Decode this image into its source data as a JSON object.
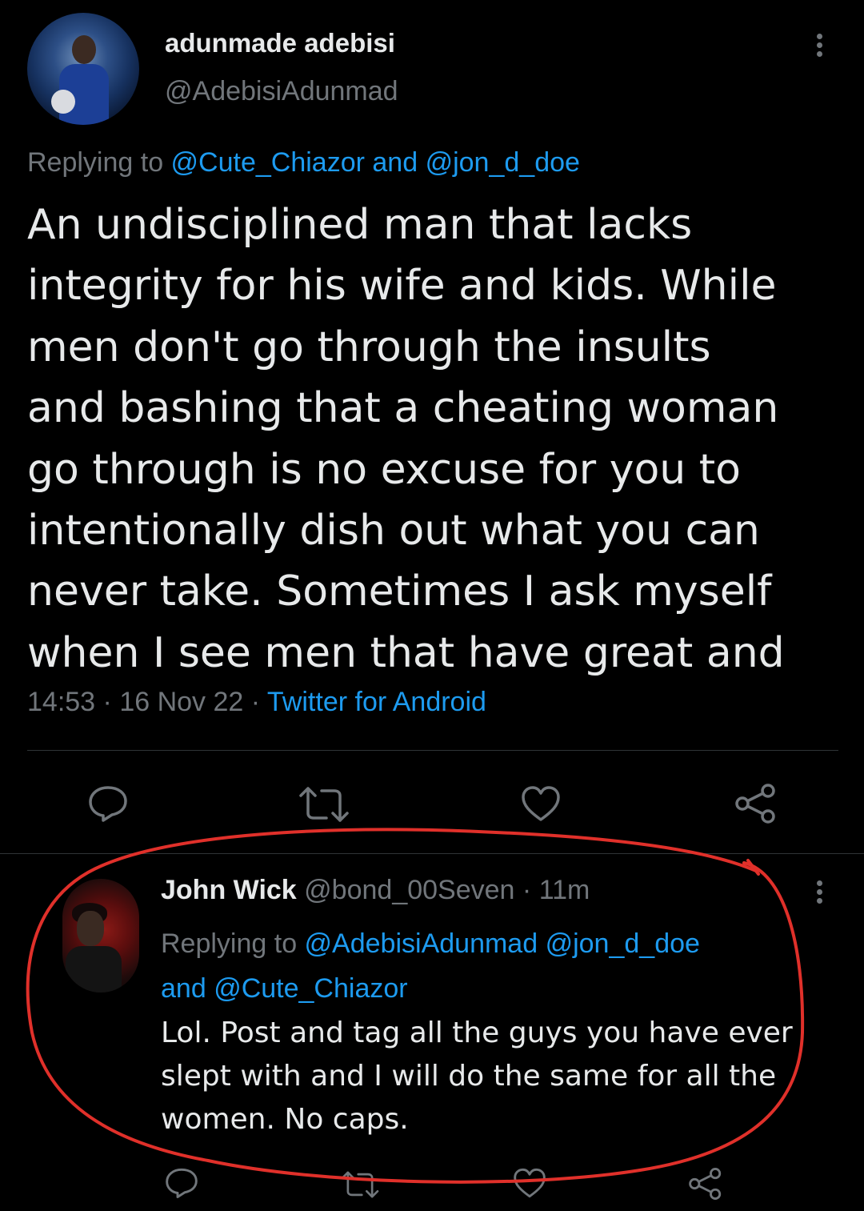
{
  "main_tweet": {
    "author_name": "adunmade adebisi",
    "author_handle": "@AdebisiAdunmad",
    "replying_prefix": "Replying to ",
    "reply_to_1": "@Cute_Chiazor",
    "reply_and": " and ",
    "reply_to_2": "@jon_d_doe",
    "text": "An undisciplined man that lacks\nintegrity for his wife and kids. While\nmen don't go through the insults\nand bashing that a cheating woman\ngo through is no excuse for you to\nintentionally dish out what you can\nnever take. Sometimes I ask myself\nwhen I see men that have great and",
    "time": "14:53",
    "date": "16 Nov 22",
    "source": "Twitter for Android",
    "sep": " · "
  },
  "reply_tweet": {
    "author_name": "John Wick",
    "author_handle": "@bond_00Seven",
    "age": "11m",
    "sep": " · ",
    "replying_prefix": "Replying to ",
    "reply_to_1": "@AdebisiAdunmad",
    "reply_to_2": "@jon_d_doe",
    "reply_and": "and ",
    "reply_to_3": "@Cute_Chiazor",
    "text_lines": [
      "Lol. Post and tag all the guys you have ever",
      "slept with and I will do the same for all the",
      "women. No caps."
    ]
  },
  "icons": {
    "more": "more-vertical-icon",
    "reply": "reply-icon",
    "retweet": "retweet-icon",
    "like": "heart-icon",
    "share": "share-icon"
  },
  "colors": {
    "background": "#000000",
    "text": "#e7e9ea",
    "secondary": "#71767b",
    "link": "#1d9bf0",
    "annotation": "#e0302a"
  }
}
